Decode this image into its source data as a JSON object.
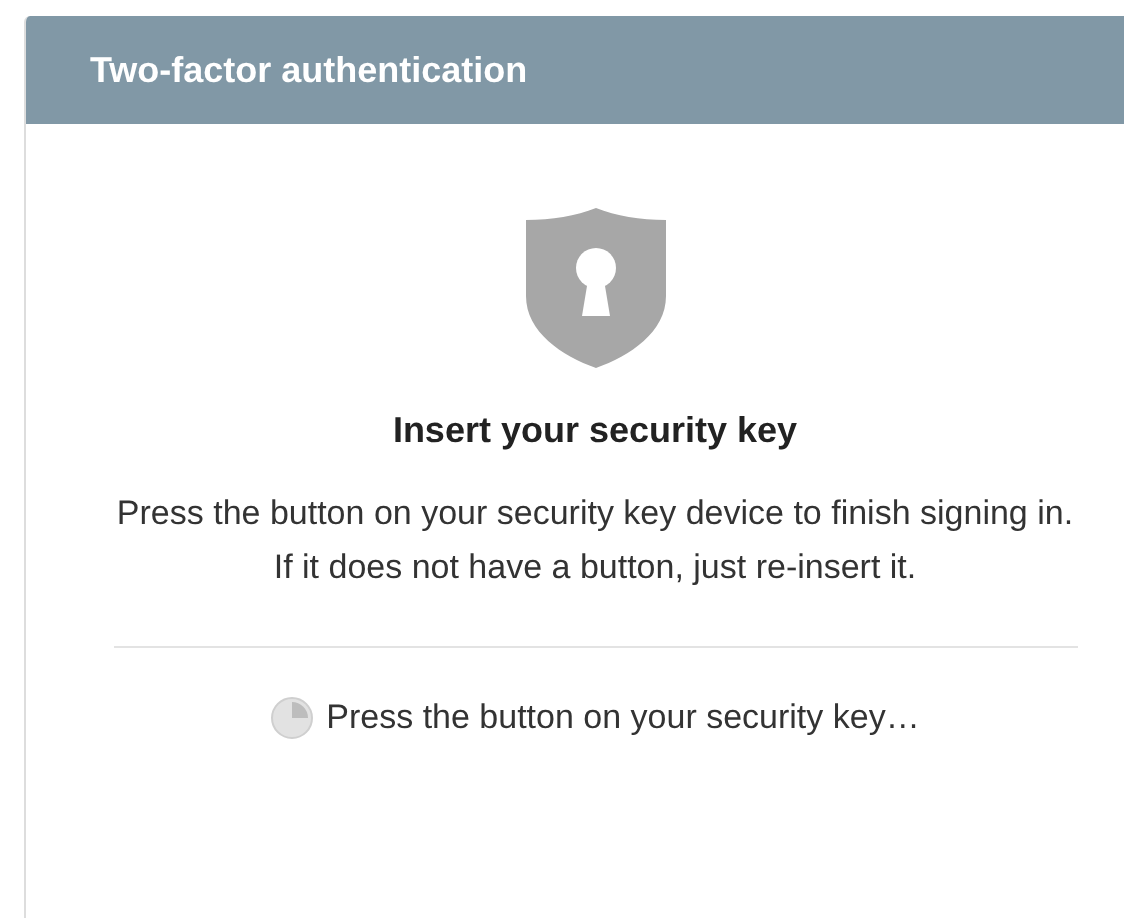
{
  "panel": {
    "title": "Two-factor authentication"
  },
  "prompt": {
    "heading": "Insert your security key",
    "message": "Press the button on your security key device to finish signing in. If it does not have a button, just re-insert it."
  },
  "status": {
    "text": "Press the button on your security key…"
  }
}
